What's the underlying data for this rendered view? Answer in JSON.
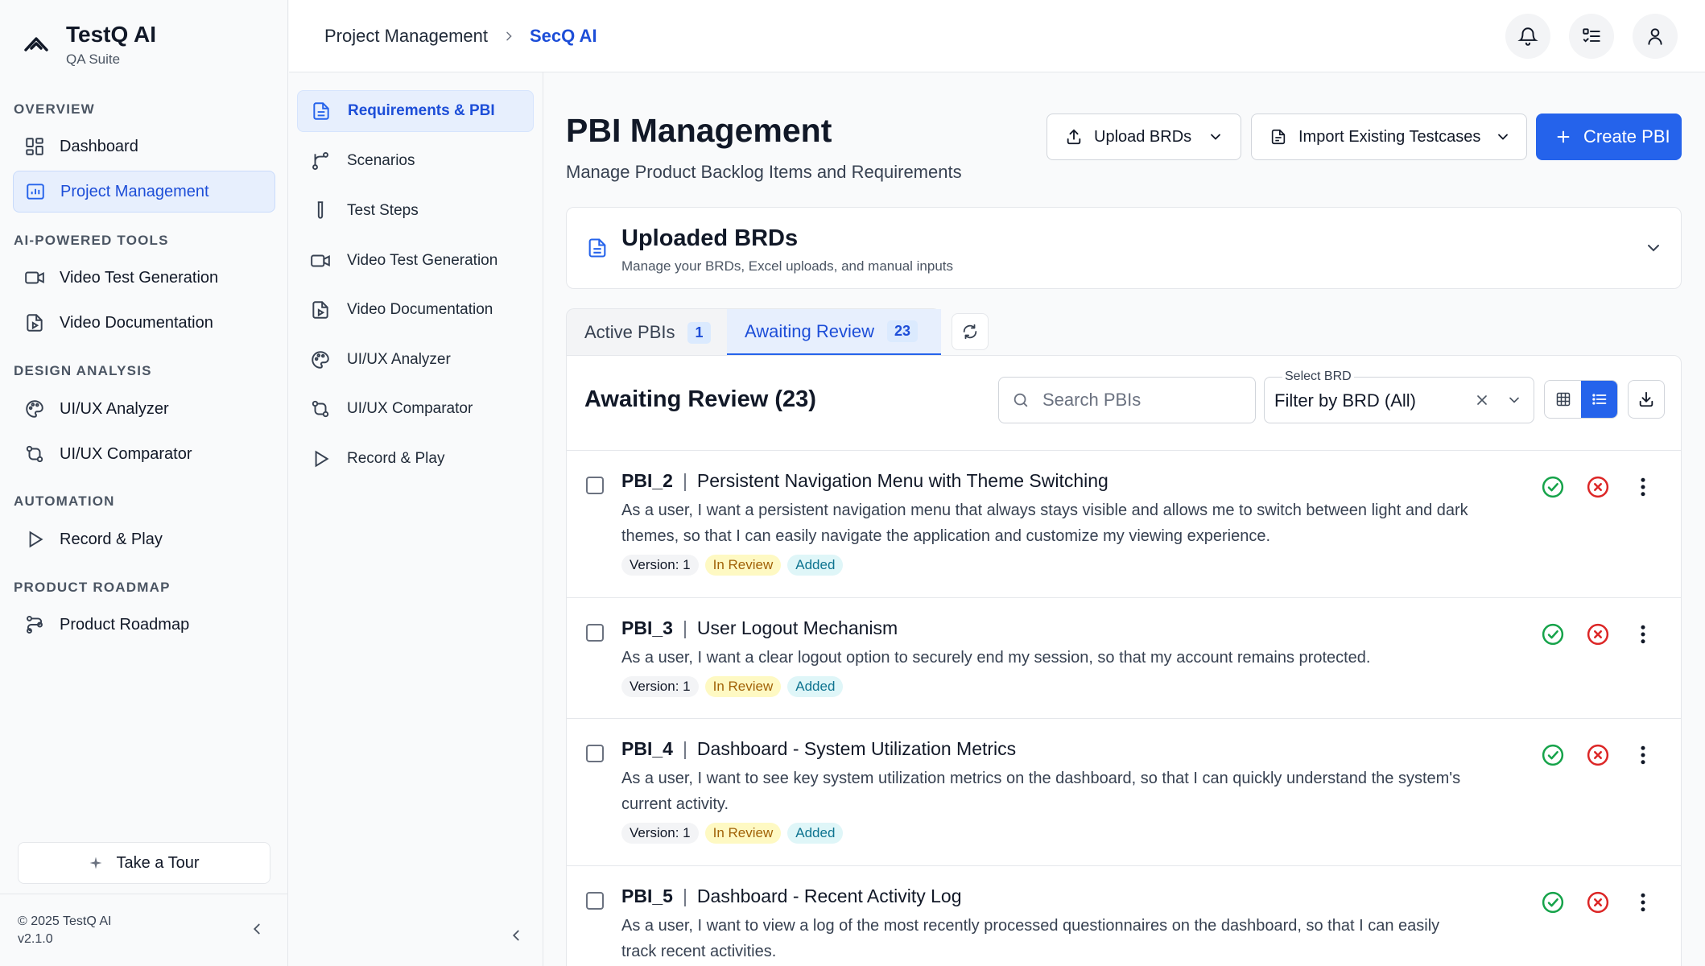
{
  "brand": {
    "name": "TestQ AI",
    "subtitle": "QA Suite"
  },
  "sidebar": {
    "sections": {
      "overview": "OVERVIEW",
      "ai_tools": "AI-POWERED TOOLS",
      "design": "DESIGN ANALYSIS",
      "automation": "AUTOMATION",
      "roadmap": "PRODUCT ROADMAP"
    },
    "items": {
      "dashboard": "Dashboard",
      "project_management": "Project Management",
      "video_test_generation": "Video Test Generation",
      "video_documentation": "Video Documentation",
      "uiux_analyzer": "UI/UX Analyzer",
      "uiux_comparator": "UI/UX Comparator",
      "record_play": "Record & Play",
      "product_roadmap": "Product Roadmap"
    },
    "tour_label": "Take a Tour",
    "copyright": "© 2025 TestQ AI",
    "version": "v2.1.0"
  },
  "header": {
    "breadcrumb_root": "Project Management",
    "breadcrumb_current": "SecQ AI"
  },
  "subnav": {
    "requirements": "Requirements & PBI",
    "scenarios": "Scenarios",
    "test_steps": "Test Steps",
    "video_test_generation": "Video Test Generation",
    "video_documentation": "Video Documentation",
    "uiux_analyzer": "UI/UX Analyzer",
    "uiux_comparator": "UI/UX Comparator",
    "record_play": "Record & Play"
  },
  "main": {
    "title": "PBI Management",
    "subtitle": "Manage Product Backlog Items and Requirements",
    "upload_label": "Upload BRDs",
    "import_label": "Import Existing Testcases",
    "create_label": "Create PBI",
    "brd_card": {
      "title": "Uploaded BRDs",
      "subtitle": "Manage your BRDs, Excel uploads, and manual inputs"
    },
    "tabs": {
      "active_label": "Active PBIs",
      "active_count": "1",
      "review_label": "Awaiting Review",
      "review_count": "23"
    },
    "list": {
      "title": "Awaiting Review  (23)",
      "search_placeholder": "Search PBIs",
      "select_label": "Select BRD",
      "select_value": "Filter by BRD (All)"
    },
    "pbis": [
      {
        "id": "PBI_2",
        "title": "Persistent Navigation Menu with Theme Switching",
        "description": "As a user, I want a persistent navigation menu that always stays visible and allows me to switch between light and dark themes, so that I can easily navigate the application and customize my viewing experience.",
        "version": "Version: 1",
        "status": "In Review",
        "change": "Added"
      },
      {
        "id": "PBI_3",
        "title": "User Logout Mechanism",
        "description": "As a user, I want a clear logout option to securely end my session, so that my account remains protected.",
        "version": "Version: 1",
        "status": "In Review",
        "change": "Added"
      },
      {
        "id": "PBI_4",
        "title": "Dashboard - System Utilization Metrics",
        "description": "As a user, I want to see key system utilization metrics on the dashboard, so that I can quickly understand the system's current activity.",
        "version": "Version: 1",
        "status": "In Review",
        "change": "Added"
      },
      {
        "id": "PBI_5",
        "title": "Dashboard - Recent Activity Log",
        "description": "As a user, I want to view a log of the most recently processed questionnaires on the dashboard, so that I can easily track recent activities.",
        "version": "",
        "status": "",
        "change": ""
      }
    ]
  }
}
